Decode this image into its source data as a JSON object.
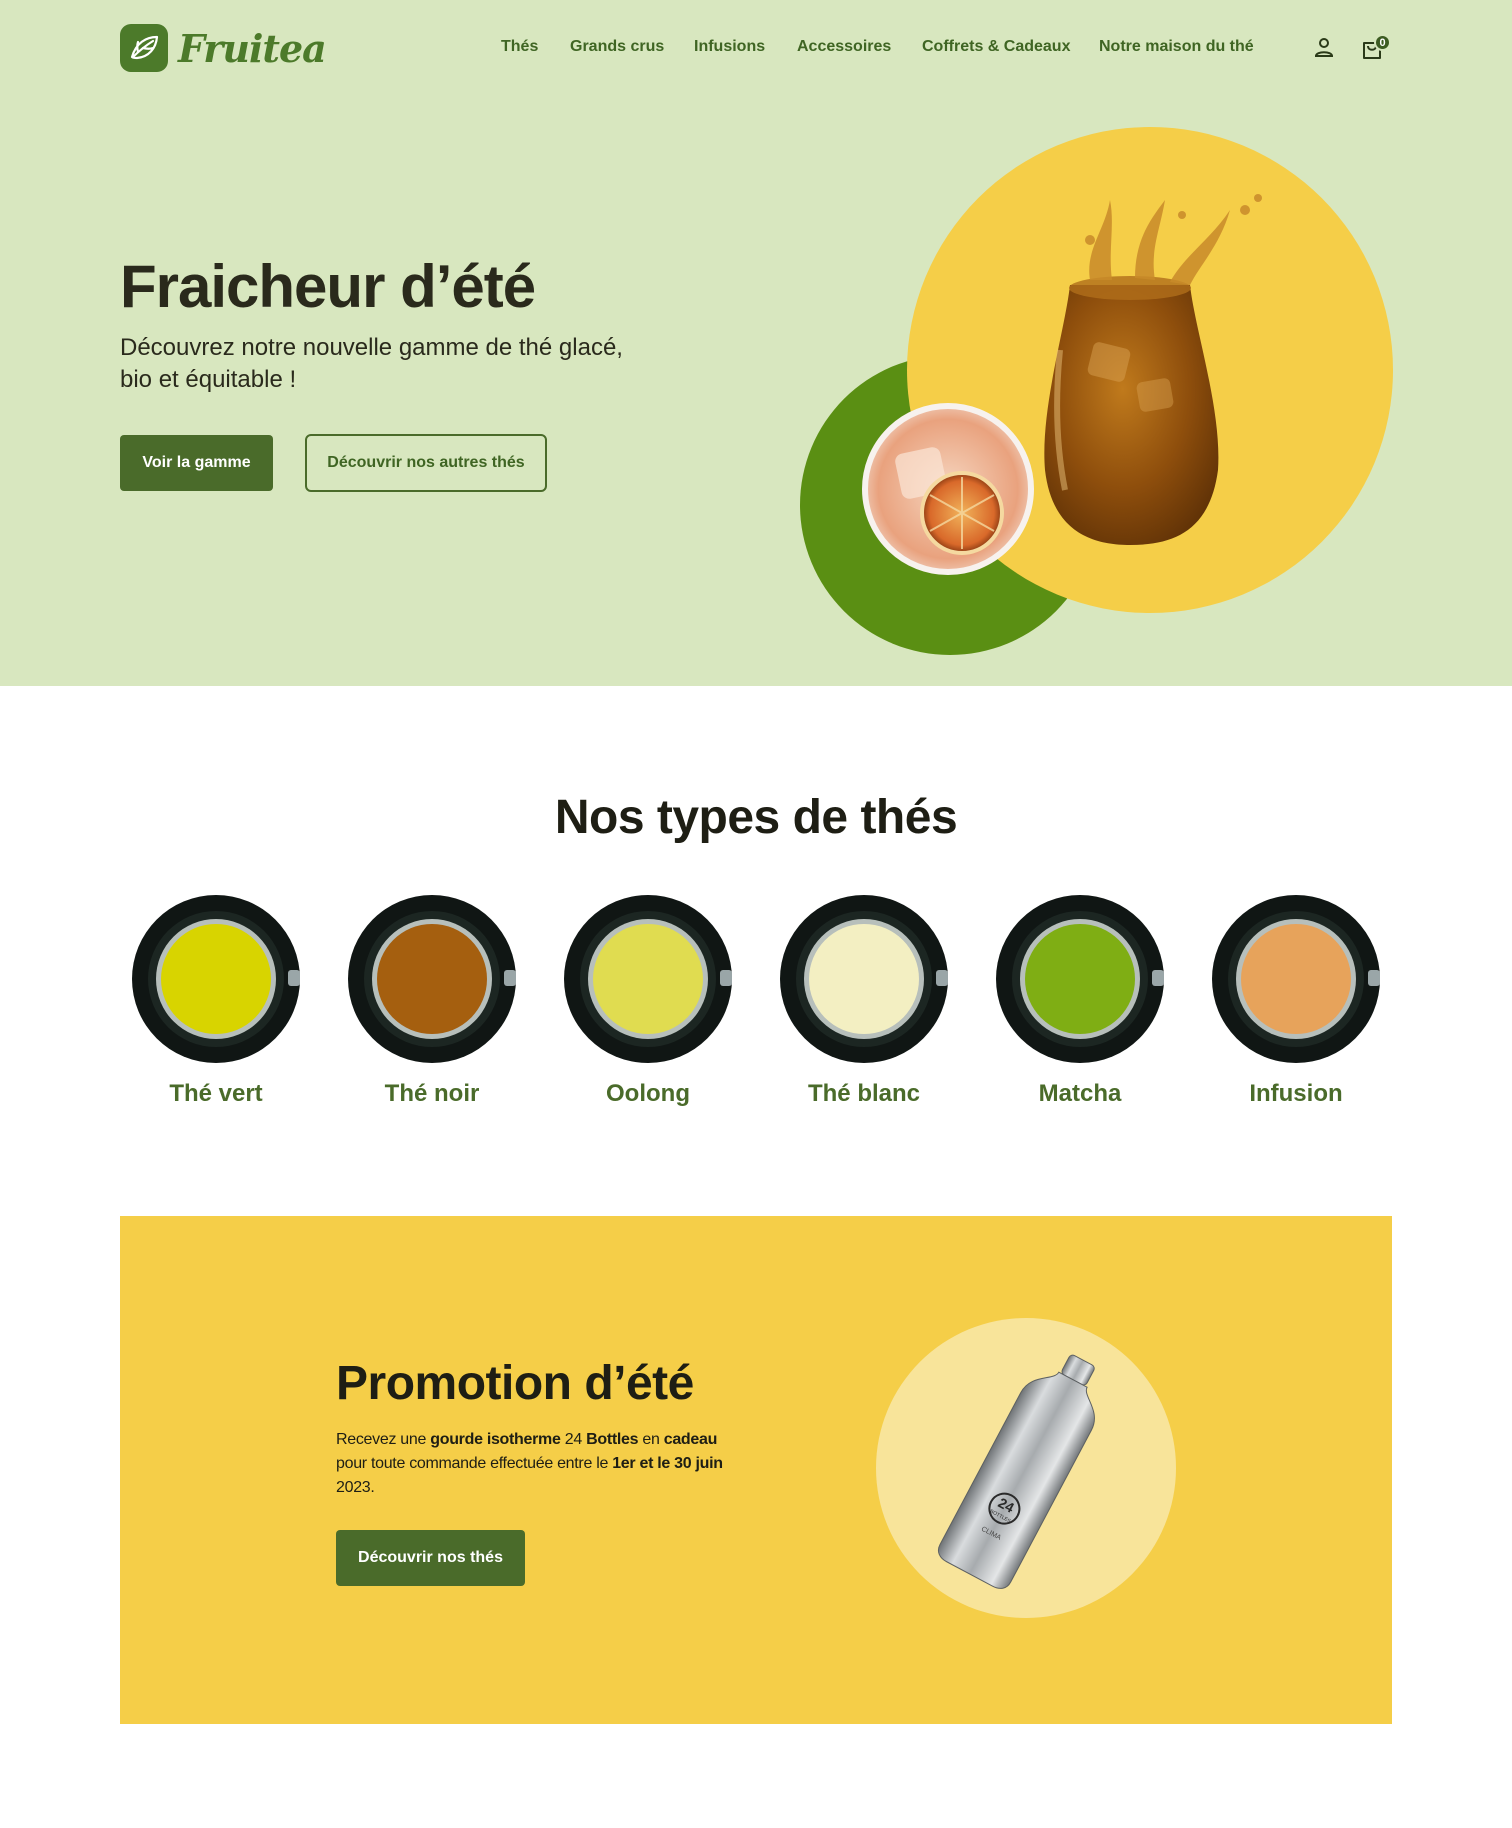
{
  "brand": {
    "name": "Fruitea",
    "color": "#4c7a2a"
  },
  "nav": {
    "items": [
      {
        "label": "Thés"
      },
      {
        "label": "Grands crus"
      },
      {
        "label": "Infusions"
      },
      {
        "label": "Accessoires"
      },
      {
        "label": "Coffrets & Cadeaux"
      },
      {
        "label": "Notre maison du thé"
      }
    ],
    "account_icon": "user-icon",
    "cart_icon": "shopping-bag-icon",
    "cart_count": "0"
  },
  "hero": {
    "title": "Fraicheur d’été",
    "subtitle": "Découvrez notre nouvelle gamme de thé glacé, bio et équitable !",
    "primary_button": "Voir la gamme",
    "secondary_button": "Découvrir nos autres thés",
    "background": "#d8e7bf",
    "circle_yellow": "#f5ce48",
    "circle_green": "#5a8f13"
  },
  "tea_types": {
    "title": "Nos types de thés",
    "items": [
      {
        "label": "Thé vert",
        "liquid": "#d8d400"
      },
      {
        "label": "Thé noir",
        "liquid": "#a55f0f"
      },
      {
        "label": "Oolong",
        "liquid": "#e0dc50"
      },
      {
        "label": "Thé blanc",
        "liquid": "#f3efc2"
      },
      {
        "label": "Matcha",
        "liquid": "#7fae14"
      },
      {
        "label": "Infusion",
        "liquid": "#e7a35b"
      }
    ]
  },
  "promo": {
    "title": "Promotion d’été",
    "text_1": "Recevez une ",
    "text_bold_1": "gourde isotherme",
    "text_2": " 24 ",
    "text_bold_2": "Bottles",
    "text_3": " en ",
    "text_bold_3": "cadeau",
    "text_4": " pour toute commande effectuée entre le ",
    "text_bold_4": "1er et le 30 juin",
    "text_5": " 2023.",
    "button": "Découvrir nos thés",
    "bottle_brand": "24",
    "bottle_sub": "BOTTLES",
    "bottle_model": "CLIMA",
    "background": "#f5ce48"
  }
}
